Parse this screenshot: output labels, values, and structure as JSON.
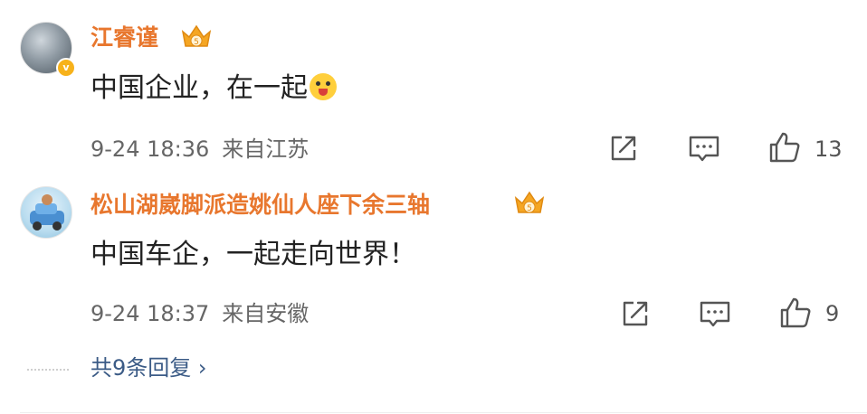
{
  "comments": [
    {
      "username": "江睿谨",
      "badge_level": "5",
      "text": "中国企业，在一起",
      "emoji": "sticker-emoji",
      "date": "9-24 18:36",
      "location": "来自江苏",
      "likes": "13"
    },
    {
      "username": "松山湖崴脚派造姚仙人座下余三轴",
      "badge_level": "5",
      "text": "中国车企，一起走向世界！",
      "date": "9-24 18:37",
      "location": "来自安徽",
      "likes": "9"
    }
  ],
  "replies_label": "共9条回复 ›",
  "icons": [
    "verified-badge-icon",
    "crown-badge-icon",
    "share-icon",
    "comment-icon",
    "like-icon"
  ],
  "colors": {
    "username": "#e8772e",
    "replies_link": "#3b5b86",
    "text": "#222222",
    "meta": "#666666"
  }
}
